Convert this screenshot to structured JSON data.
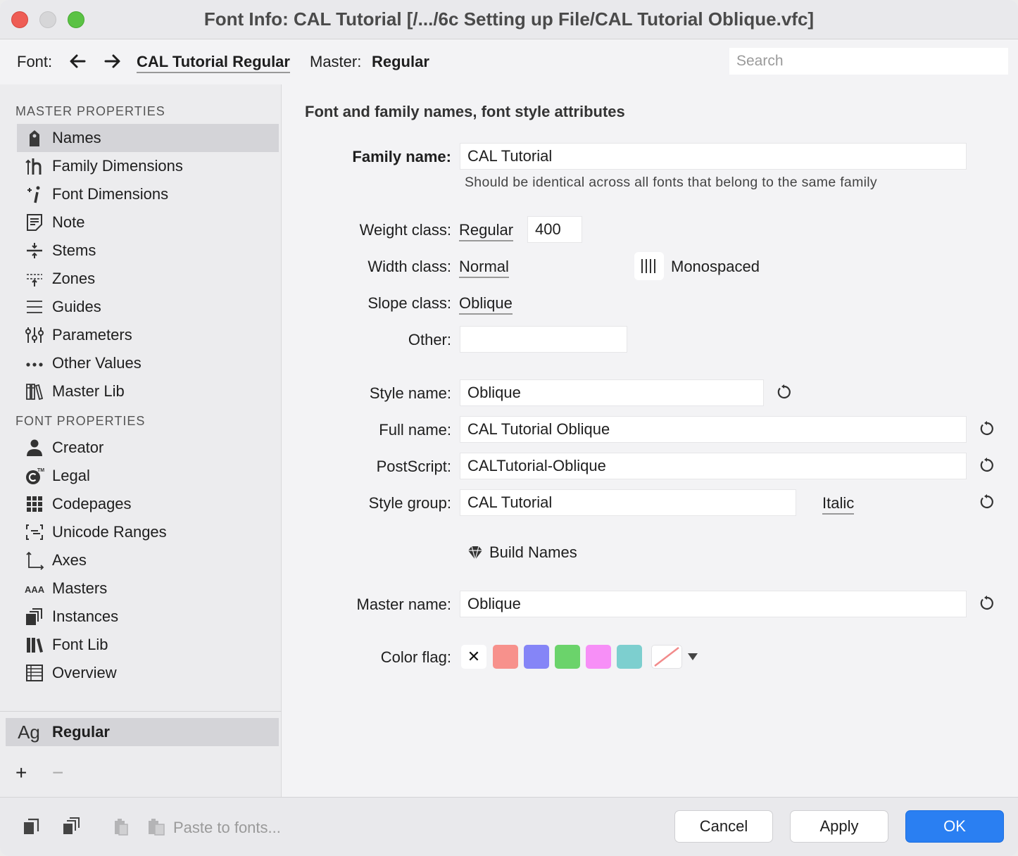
{
  "window": {
    "title": "Font Info: CAL Tutorial [/.../6c Setting up File/CAL Tutorial Oblique.vfc]"
  },
  "toolbar": {
    "font_label": "Font:",
    "font_name": "CAL Tutorial Regular",
    "master_label": "Master:",
    "master_name": "Regular",
    "search_placeholder": "Search"
  },
  "sidebar": {
    "master_heading": "MASTER PROPERTIES",
    "master_items": [
      {
        "label": "Names",
        "icon": "tag-icon",
        "active": true
      },
      {
        "label": "Family Dimensions",
        "icon": "family-dimensions-icon"
      },
      {
        "label": "Font Dimensions",
        "icon": "font-dimensions-icon"
      },
      {
        "label": "Note",
        "icon": "note-icon"
      },
      {
        "label": "Stems",
        "icon": "stems-icon"
      },
      {
        "label": "Zones",
        "icon": "zones-icon"
      },
      {
        "label": "Guides",
        "icon": "guides-icon"
      },
      {
        "label": "Parameters",
        "icon": "sliders-icon"
      },
      {
        "label": "Other Values",
        "icon": "ellipsis-icon"
      },
      {
        "label": "Master Lib",
        "icon": "library-icon"
      }
    ],
    "font_heading": "FONT PROPERTIES",
    "font_items": [
      {
        "label": "Creator",
        "icon": "person-icon"
      },
      {
        "label": "Legal",
        "icon": "copyright-icon"
      },
      {
        "label": "Codepages",
        "icon": "grid-icon"
      },
      {
        "label": "Unicode Ranges",
        "icon": "unicode-ranges-icon"
      },
      {
        "label": "Axes",
        "icon": "axes-icon"
      },
      {
        "label": "Masters",
        "icon": "masters-icon"
      },
      {
        "label": "Instances",
        "icon": "instances-icon"
      },
      {
        "label": "Font Lib",
        "icon": "books-icon"
      },
      {
        "label": "Overview",
        "icon": "table-icon"
      }
    ],
    "master_glyph": "Ag",
    "master_entry": "Regular",
    "add_label": "+",
    "remove_label": "−"
  },
  "main": {
    "heading": "Font and family names, font style attributes",
    "family_label": "Family name:",
    "family_value": "CAL Tutorial",
    "family_hint": "Should be identical across all fonts that belong to the same family",
    "weight_label": "Weight class:",
    "weight_value": "Regular",
    "weight_number": "400",
    "width_label": "Width class:",
    "width_value": "Normal",
    "monospaced_label": "Monospaced",
    "slope_label": "Slope class:",
    "slope_value": "Oblique",
    "other_label": "Other:",
    "other_value": "",
    "style_label": "Style name:",
    "style_value": "Oblique",
    "fullname_label": "Full name:",
    "fullname_value": "CAL Tutorial Oblique",
    "postscript_label": "PostScript:",
    "postscript_value": "CALTutorial-Oblique",
    "stylegroup_label": "Style group:",
    "stylegroup_value": "CAL Tutorial",
    "stylegroup_style": "Italic",
    "build_label": "Build Names",
    "mastername_label": "Master name:",
    "mastername_value": "Oblique",
    "colorflag_label": "Color flag:",
    "colorflag_none": "✕",
    "color_swatches": [
      "#f7918c",
      "#8585f7",
      "#6bd36b",
      "#f78ff7",
      "#7dcfcf"
    ]
  },
  "footer": {
    "paste_label": "Paste to fonts...",
    "cancel_label": "Cancel",
    "apply_label": "Apply",
    "ok_label": "OK"
  },
  "colors": {
    "accent": "#2a7ff2",
    "close": "#ee5d55",
    "maximize": "#5ac244"
  }
}
